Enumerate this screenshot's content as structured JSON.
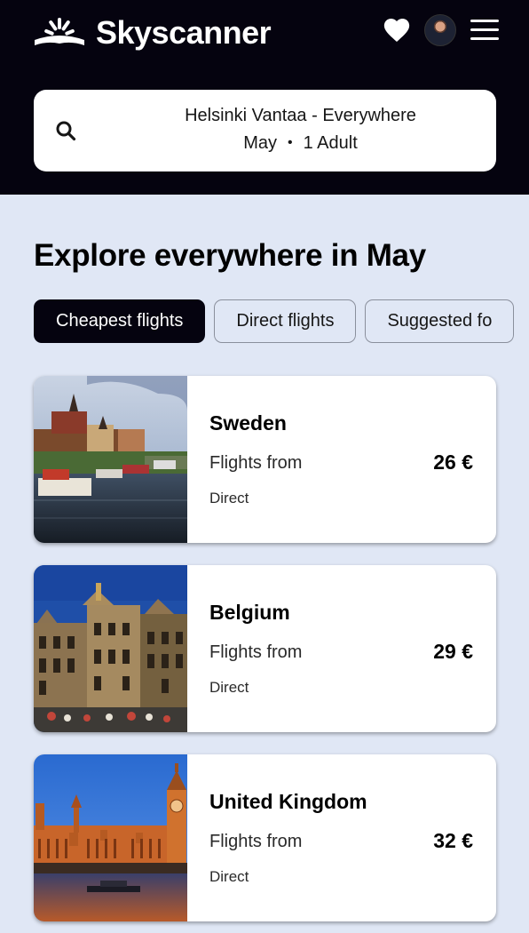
{
  "header": {
    "logo_text": "Skyscanner",
    "icons": [
      "skyscanner-sunrise-logo",
      "heart-icon",
      "avatar",
      "hamburger-menu-icon"
    ]
  },
  "search": {
    "route": "Helsinki Vantaa - Everywhere",
    "month": "May",
    "separator": "•",
    "travellers": "1 Adult"
  },
  "main": {
    "heading": "Explore everywhere in May",
    "filters": [
      {
        "label": "Cheapest flights",
        "selected": true
      },
      {
        "label": "Direct flights",
        "selected": false
      },
      {
        "label": "Suggested fo",
        "selected": false
      }
    ],
    "results": [
      {
        "country": "Sweden",
        "flights_from": "Flights from",
        "price": "26 €",
        "stops": "Direct"
      },
      {
        "country": "Belgium",
        "flights_from": "Flights from",
        "price": "29 €",
        "stops": "Direct"
      },
      {
        "country": "United Kingdom",
        "flights_from": "Flights from",
        "price": "32 €",
        "stops": "Direct"
      }
    ]
  },
  "colors": {
    "topbar": "#05030f",
    "page_background": "#e0e7f5",
    "active_chip": "#05030f"
  }
}
